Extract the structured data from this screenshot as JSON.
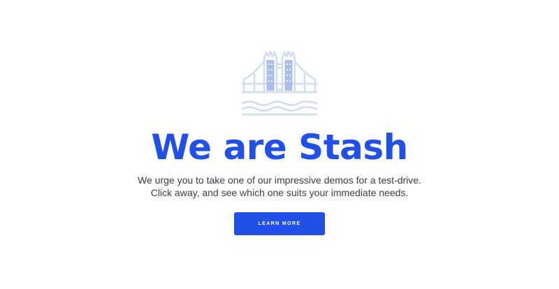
{
  "hero": {
    "logo_icon": "tower-bridge-icon",
    "headline": "We are Stash",
    "subtext_line1": "We urge you to take one of our impressive demos for a test-drive.",
    "subtext_line2": "Click away, and see which one suits your immediate needs.",
    "cta_label": "LEARN MORE"
  },
  "colors": {
    "accent": "#2150e8",
    "logo_light": "#cfdcf1",
    "logo_mid": "#a9bdf0",
    "body_text": "#3b3f4a",
    "background": "#ffffff"
  }
}
